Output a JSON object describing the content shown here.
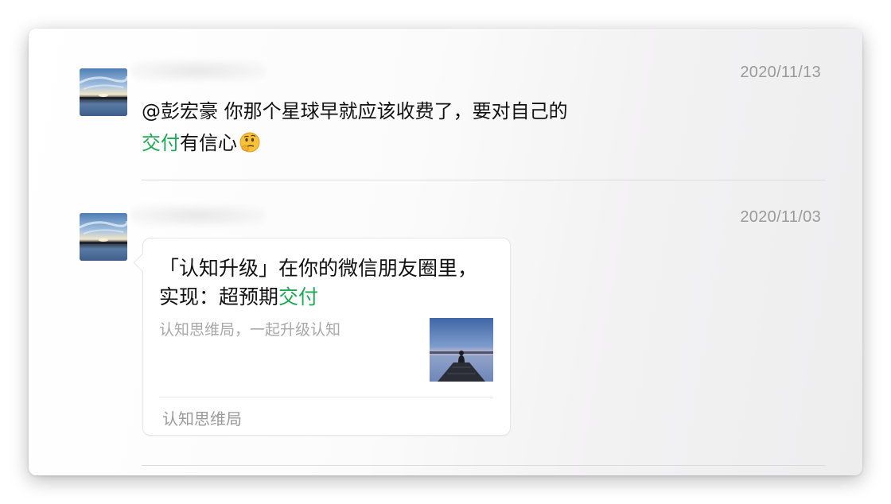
{
  "moments": [
    {
      "date": "2020/11/13",
      "comment": {
        "mention": "@彭宏豪",
        "text_line1": " 你那个星球早就应该收费了，要对自己的",
        "highlight": "交付",
        "text_line2": "有信心",
        "emoji": "thinking-face"
      }
    },
    {
      "date": "2020/11/03",
      "share": {
        "title_prefix": "「认知升级」在你的微信朋友圈里，实现：超预期",
        "title_highlight": "交付",
        "description": "认知思维局，一起升级认知",
        "source": "认知思维局",
        "thumbnail": "person-on-pier-at-sunset"
      }
    }
  ],
  "colors": {
    "highlight": "#1fa855",
    "date": "#9a9a9a",
    "text": "#111111",
    "muted": "#a8a8a8"
  }
}
